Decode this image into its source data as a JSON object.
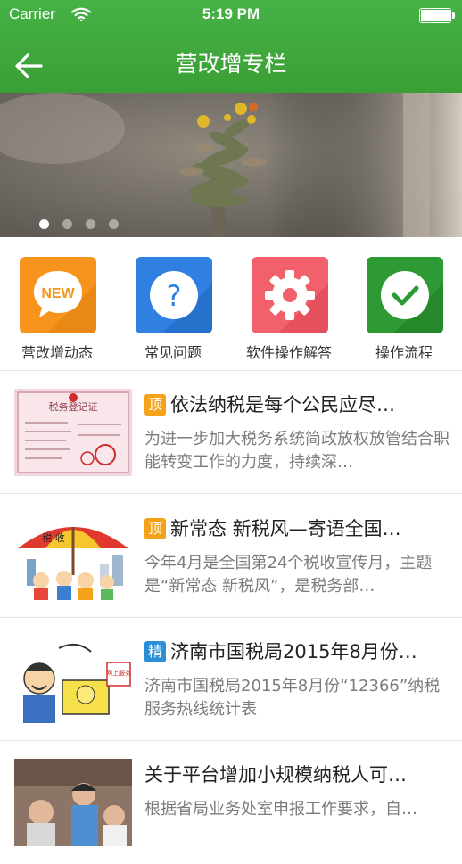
{
  "status_bar": {
    "carrier": "Carrier",
    "time": "5:19 PM"
  },
  "nav": {
    "title": "营改增专栏"
  },
  "banner": {
    "active_slide": 1,
    "slide_count": 4
  },
  "menu": [
    {
      "label": "营改增动态",
      "icon": "new-icon",
      "color": "#f7941d",
      "icon_text": "NEW"
    },
    {
      "label": "常见问题",
      "icon": "question-icon",
      "color": "#2f80e0",
      "icon_text": "?"
    },
    {
      "label": "软件操作解答",
      "icon": "gear-icon",
      "color": "#f2606c",
      "icon_text": ""
    },
    {
      "label": "操作流程",
      "icon": "checkmark-icon",
      "color": "#2e9a33",
      "icon_text": ""
    }
  ],
  "news": [
    {
      "badge": "顶",
      "badge_type": "top",
      "title": "依法纳税是每个公民应尽…",
      "summary": "为进一步加大税务系统简政放权放管结合职能转变工作的力度，持续深…",
      "thumb_text": "税务登记证"
    },
    {
      "badge": "顶",
      "badge_type": "top",
      "title": "新常态 新税风—寄语全国…",
      "summary": "今年4月是全国第24个税收宣传月，主题是“新常态 新税风”，是税务部…",
      "thumb_text": "税 收"
    },
    {
      "badge": "精",
      "badge_type": "fine",
      "title": "济南市国税局2015年8月份…",
      "summary": "济南市国税局2015年8月份“12366”纳税服务热线统计表",
      "thumb_text": "网上服务"
    },
    {
      "badge": "",
      "badge_type": "none",
      "title": "关于平台增加小规模纳税人可…",
      "summary": "根据省局业务处室申报工作要求，自…",
      "thumb_text": ""
    }
  ]
}
